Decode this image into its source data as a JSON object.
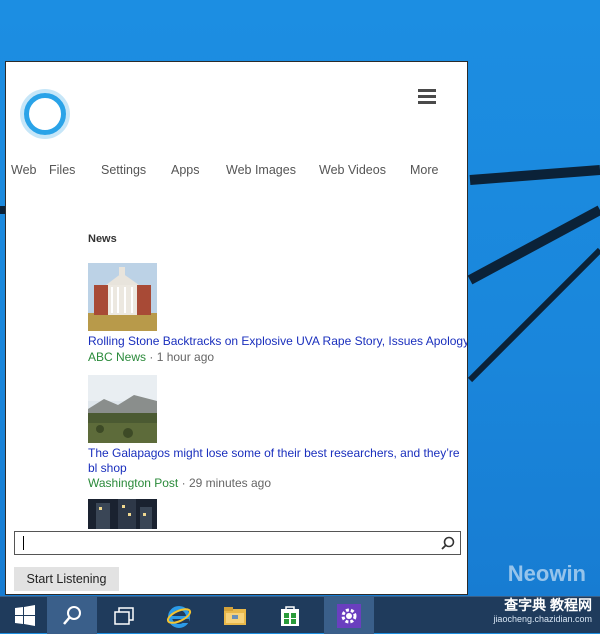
{
  "desktop": {
    "watermark": "Neowin",
    "accent": "#1e8fe0"
  },
  "panel": {
    "tabs": [
      {
        "label": "Web"
      },
      {
        "label": "Files"
      },
      {
        "label": "Settings"
      },
      {
        "label": "Apps"
      },
      {
        "label": "Web Images"
      },
      {
        "label": "Web Videos"
      },
      {
        "label": "More"
      }
    ],
    "news_heading": "News",
    "news": [
      {
        "title": "Rolling Stone Backtracks on Explosive UVA Rape Story, Issues Apology",
        "source": "ABC News",
        "time": "· 1 hour ago",
        "thumb_icon": "building-photo"
      },
      {
        "title": "The Galapagos might lose some of their best researchers, and they’re bl shop",
        "source": "Washington Post",
        "time": "· 29 minutes ago",
        "thumb_icon": "landscape-photo"
      },
      {
        "title": "",
        "source": "",
        "time": "",
        "thumb_icon": "city-night-photo"
      }
    ],
    "search": {
      "value": "",
      "placeholder": ""
    },
    "start_listening": "Start Listening"
  },
  "taskbar": {
    "items": [
      {
        "icon": "windows-start-icon"
      },
      {
        "icon": "search-icon"
      },
      {
        "icon": "task-view-icon"
      },
      {
        "icon": "internet-explorer-icon"
      },
      {
        "icon": "file-explorer-icon"
      },
      {
        "icon": "store-icon"
      },
      {
        "icon": "settings-icon"
      }
    ],
    "color": "#1f3b5c"
  },
  "corner_watermark": {
    "line1": "查字典 教程网",
    "line2": "jiaocheng.chazidian.com"
  }
}
